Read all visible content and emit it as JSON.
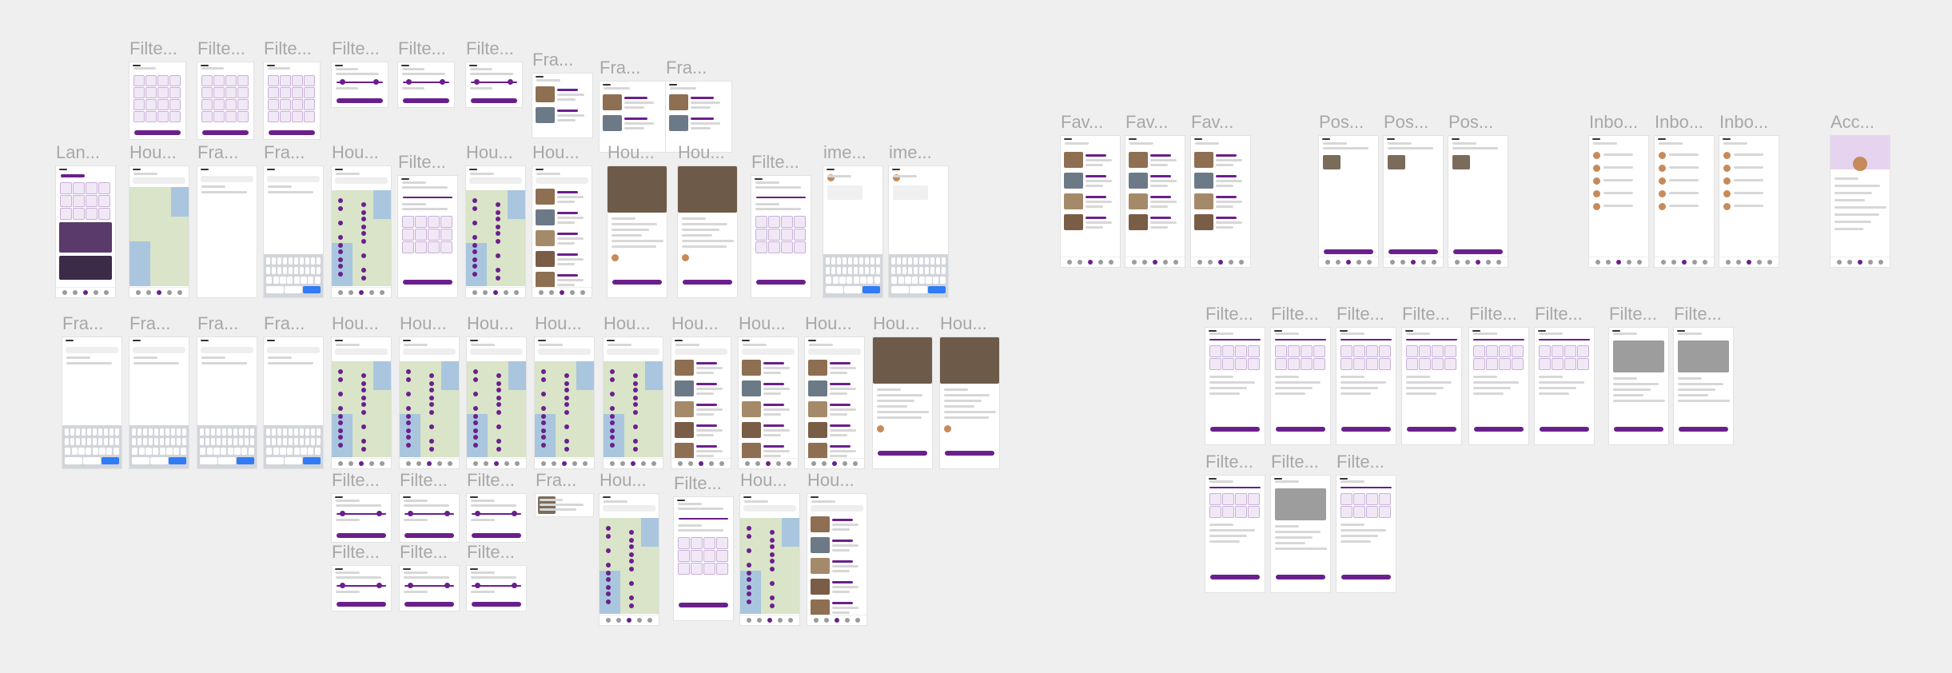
{
  "canvas": {
    "background": "#efefef",
    "accent": "#6b1f8c"
  },
  "frames": [
    {
      "id": "f1",
      "label": "Filte...",
      "kind": "filter-grid"
    },
    {
      "id": "f2",
      "label": "Filte...",
      "kind": "filter-grid"
    },
    {
      "id": "f3",
      "label": "Filte...",
      "kind": "filter-grid"
    },
    {
      "id": "f4",
      "label": "Filte...",
      "kind": "filter-price"
    },
    {
      "id": "f5",
      "label": "Filte...",
      "kind": "filter-beds"
    },
    {
      "id": "f6",
      "label": "Filte...",
      "kind": "filter-sort"
    },
    {
      "id": "f7",
      "label": "Fra...",
      "kind": "favorites-list"
    },
    {
      "id": "f8",
      "label": "Fra...",
      "kind": "share-list"
    },
    {
      "id": "f9",
      "label": "Fra...",
      "kind": "share-list"
    },
    {
      "id": "f10",
      "label": "Lan...",
      "kind": "landing"
    },
    {
      "id": "f11",
      "label": "Hou...",
      "kind": "map-plain"
    },
    {
      "id": "f12",
      "label": "Fra...",
      "kind": "search-blank"
    },
    {
      "id": "f13",
      "label": "Fra...",
      "kind": "search-keyboard"
    },
    {
      "id": "f14",
      "label": "Hou...",
      "kind": "map-pins"
    },
    {
      "id": "f15",
      "label": "Filte...",
      "kind": "filter-full"
    },
    {
      "id": "f16",
      "label": "Hou...",
      "kind": "map-pins"
    },
    {
      "id": "f17",
      "label": "Hou...",
      "kind": "house-list"
    },
    {
      "id": "f18",
      "label": "Hou...",
      "kind": "house-detail"
    },
    {
      "id": "f19",
      "label": "Hou...",
      "kind": "house-detail"
    },
    {
      "id": "f20",
      "label": "Filte...",
      "kind": "filter-full"
    },
    {
      "id": "f21",
      "label": "ime...",
      "kind": "chat"
    },
    {
      "id": "f22",
      "label": "ime...",
      "kind": "chat"
    },
    {
      "id": "f23",
      "label": "Fav...",
      "kind": "fav-list"
    },
    {
      "id": "f24",
      "label": "Fav...",
      "kind": "fav-list"
    },
    {
      "id": "f25",
      "label": "Fav...",
      "kind": "fav-list"
    },
    {
      "id": "f26",
      "label": "Pos...",
      "kind": "post"
    },
    {
      "id": "f27",
      "label": "Pos...",
      "kind": "post"
    },
    {
      "id": "f28",
      "label": "Pos...",
      "kind": "post"
    },
    {
      "id": "f29",
      "label": "Inbo...",
      "kind": "inbox"
    },
    {
      "id": "f30",
      "label": "Inbo...",
      "kind": "inbox"
    },
    {
      "id": "f31",
      "label": "Inbo...",
      "kind": "inbox"
    },
    {
      "id": "f32",
      "label": "Acc...",
      "kind": "account"
    },
    {
      "id": "f33",
      "label": "Fra...",
      "kind": "search-keyboard"
    },
    {
      "id": "f34",
      "label": "Fra...",
      "kind": "search-keyboard"
    },
    {
      "id": "f35",
      "label": "Fra...",
      "kind": "search-keyboard"
    },
    {
      "id": "f36",
      "label": "Fra...",
      "kind": "search-keyboard"
    },
    {
      "id": "f37",
      "label": "Hou...",
      "kind": "map-pins"
    },
    {
      "id": "f38",
      "label": "Hou...",
      "kind": "map-pins"
    },
    {
      "id": "f39",
      "label": "Hou...",
      "kind": "map-pins"
    },
    {
      "id": "f40",
      "label": "Hou...",
      "kind": "map-pins"
    },
    {
      "id": "f41",
      "label": "Hou...",
      "kind": "map-pins"
    },
    {
      "id": "f42",
      "label": "Hou...",
      "kind": "house-list"
    },
    {
      "id": "f43",
      "label": "Hou...",
      "kind": "house-list"
    },
    {
      "id": "f44",
      "label": "Hou...",
      "kind": "house-list"
    },
    {
      "id": "f45",
      "label": "Hou...",
      "kind": "house-detail"
    },
    {
      "id": "f46",
      "label": "Hou...",
      "kind": "house-detail"
    },
    {
      "id": "f47",
      "label": "Filte...",
      "kind": "post-step"
    },
    {
      "id": "f48",
      "label": "Filte...",
      "kind": "post-step"
    },
    {
      "id": "f49",
      "label": "Filte...",
      "kind": "post-step"
    },
    {
      "id": "f50",
      "label": "Filte...",
      "kind": "post-step"
    },
    {
      "id": "f51",
      "label": "Filte...",
      "kind": "post-step"
    },
    {
      "id": "f52",
      "label": "Filte...",
      "kind": "post-step"
    },
    {
      "id": "f53",
      "label": "Filte...",
      "kind": "post-photo"
    },
    {
      "id": "f54",
      "label": "Filte...",
      "kind": "post-photo"
    },
    {
      "id": "f55",
      "label": "Filte...",
      "kind": "filter-price"
    },
    {
      "id": "f56",
      "label": "Filte...",
      "kind": "filter-beds"
    },
    {
      "id": "f57",
      "label": "Filte...",
      "kind": "filter-sort"
    },
    {
      "id": "f58",
      "label": "Fra...",
      "kind": "card"
    },
    {
      "id": "f59",
      "label": "Hou...",
      "kind": "map-pins"
    },
    {
      "id": "f60",
      "label": "Filte...",
      "kind": "filter-full"
    },
    {
      "id": "f61",
      "label": "Hou...",
      "kind": "map-pins"
    },
    {
      "id": "f62",
      "label": "Hou...",
      "kind": "house-list"
    },
    {
      "id": "f63",
      "label": "Filte...",
      "kind": "filter-price"
    },
    {
      "id": "f64",
      "label": "Filte...",
      "kind": "filter-beds"
    },
    {
      "id": "f65",
      "label": "Filte...",
      "kind": "filter-sort"
    },
    {
      "id": "f66",
      "label": "Filte...",
      "kind": "post-step"
    },
    {
      "id": "f67",
      "label": "Filte...",
      "kind": "post-photo"
    },
    {
      "id": "f68",
      "label": "Filte...",
      "kind": "post-step"
    }
  ]
}
